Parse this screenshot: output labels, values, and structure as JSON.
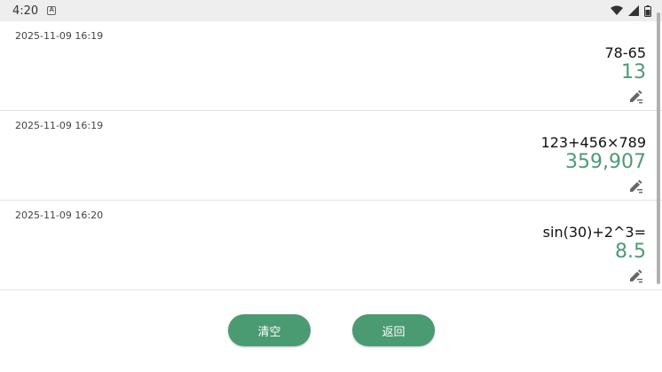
{
  "status_bar": {
    "time": "4:20",
    "icons": [
      "notification-a-icon",
      "wifi-icon",
      "signal-icon",
      "battery-icon"
    ]
  },
  "history": {
    "entries": [
      {
        "timestamp": "2025-11-09 16:19",
        "expression": "78-65",
        "result": "13"
      },
      {
        "timestamp": "2025-11-09 16:19",
        "expression": "123+456×789",
        "result": "359,907"
      },
      {
        "timestamp": "2025-11-09 16:20",
        "expression": "sin(30)+2^3=",
        "result": "8.5"
      }
    ]
  },
  "buttons": {
    "clear_label": "清空",
    "back_label": "返回"
  },
  "colors": {
    "accent": "#4a9a72",
    "result_text": "#4e9a74",
    "status_bar_bg": "#eeeeee"
  }
}
